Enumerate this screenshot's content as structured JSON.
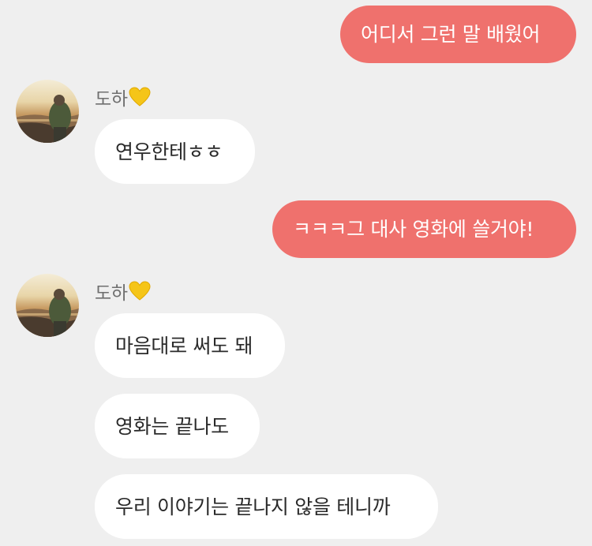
{
  "messages": [
    {
      "from": "me",
      "text": "어디서 그런 말 배웠어"
    },
    {
      "from": "them",
      "sender": "도하",
      "avatar": "sunset-photo-avatar",
      "text": "연우한테ㅎㅎ"
    },
    {
      "from": "me",
      "text": "ㅋㅋㅋ그 대사 영화에 쓸거야!"
    },
    {
      "from": "them",
      "sender": "도하",
      "avatar": "sunset-photo-avatar",
      "text": "마음대로 써도 돼"
    },
    {
      "from": "them",
      "text": "영화는 끝나도"
    },
    {
      "from": "them",
      "text": "우리 이야기는 끝나지 않을 테니까"
    }
  ],
  "colors": {
    "background": "#efefef",
    "my_bubble": "#ef716d",
    "their_bubble": "#ffffff",
    "sender_name": "#6f6f6f",
    "heart": "#f5c518"
  },
  "icons": {
    "sender_badge": "yellow-heart-icon"
  }
}
